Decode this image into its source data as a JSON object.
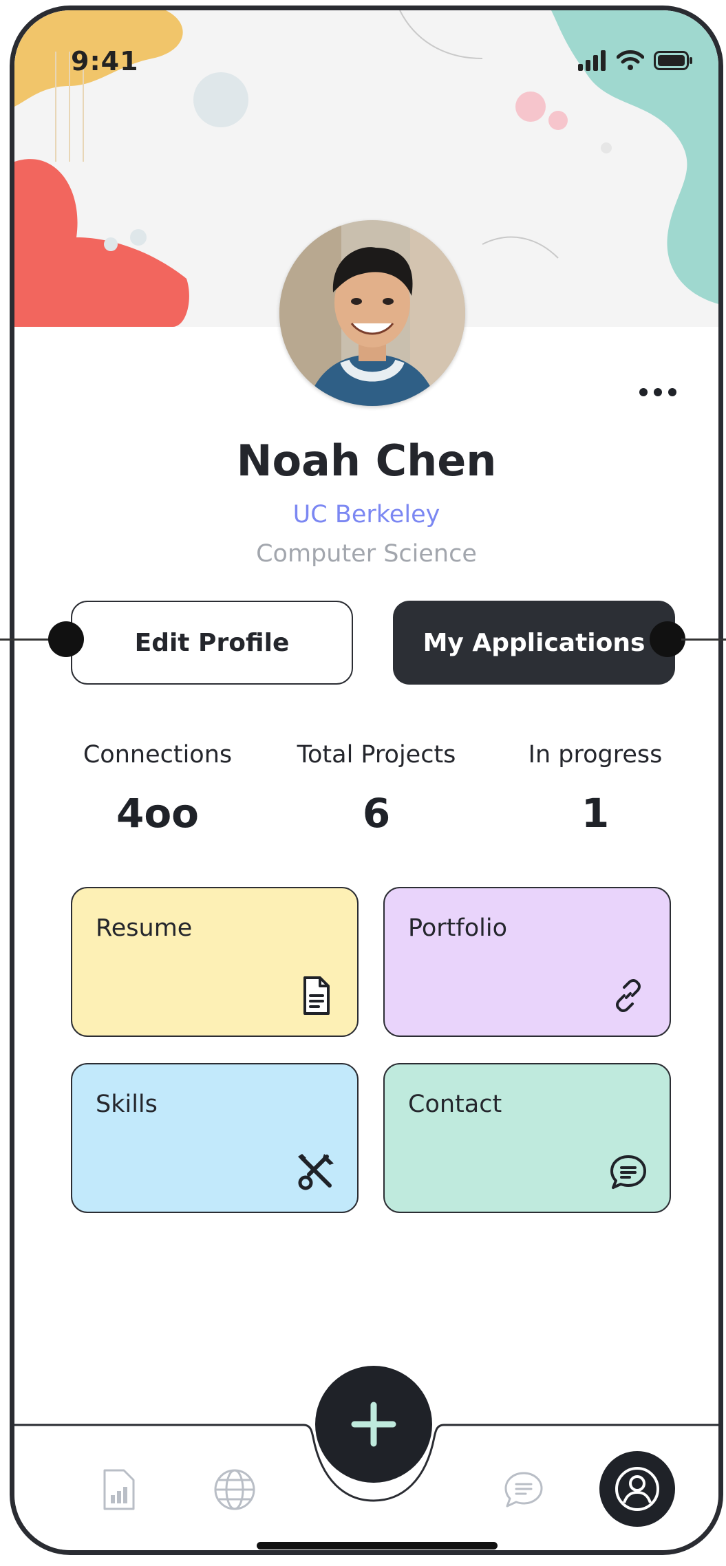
{
  "status_bar": {
    "time": "9:41"
  },
  "profile": {
    "name": "Noah Chen",
    "school": "UC Berkeley",
    "major": "Computer Science"
  },
  "actions": {
    "edit_profile": "Edit Profile",
    "my_applications": "My Applications"
  },
  "stats": [
    {
      "label": "Connections",
      "value": "4oo"
    },
    {
      "label": "Total Projects",
      "value": "6"
    },
    {
      "label": "In progress",
      "value": "1"
    }
  ],
  "cards": [
    {
      "title": "Resume",
      "icon": "document-icon",
      "color": "#fdf0b5"
    },
    {
      "title": "Portfolio",
      "icon": "link-icon",
      "color": "#e9d4fb"
    },
    {
      "title": "Skills",
      "icon": "tools-icon",
      "color": "#c2e9fb"
    },
    {
      "title": "Contact",
      "icon": "chat-icon",
      "color": "#bfeadd"
    }
  ],
  "tab_bar": {
    "items": [
      "stats-icon",
      "globe-icon",
      "add-icon",
      "message-icon",
      "profile-icon"
    ]
  },
  "colors": {
    "accent": "#7b87f2",
    "dark": "#2c2f35"
  }
}
